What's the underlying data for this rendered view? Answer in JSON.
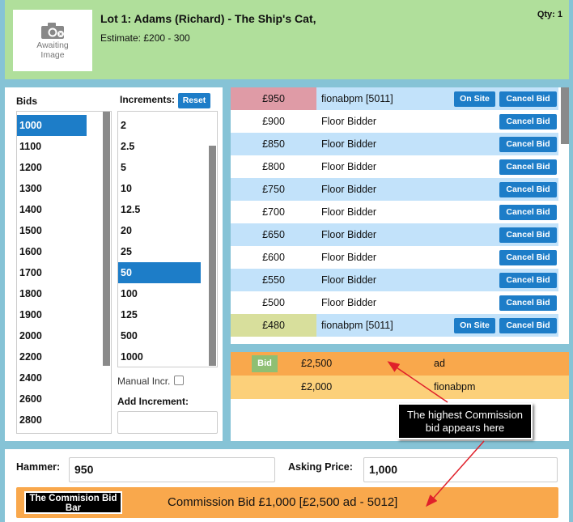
{
  "header": {
    "image_caption": "Awaiting Image",
    "lot_title": "Lot 1: Adams (Richard) - The Ship's Cat,",
    "estimate": "Estimate: £200 - 300",
    "qty": "Qty: 1"
  },
  "bids": {
    "label": "Bids",
    "items": [
      "1000",
      "1100",
      "1200",
      "1300",
      "1400",
      "1500",
      "1600",
      "1700",
      "1800",
      "1900",
      "2000",
      "2200",
      "2400",
      "2600",
      "2800"
    ],
    "selected": "1000"
  },
  "increments": {
    "label": "Increments:",
    "reset_label": "Reset",
    "items": [
      "2",
      "2.5",
      "5",
      "10",
      "12.5",
      "20",
      "25",
      "50",
      "100",
      "125",
      "500",
      "1000"
    ],
    "selected": "50",
    "manual_label": "Manual Incr.",
    "add_label": "Add Increment:",
    "add_value": ""
  },
  "history": {
    "onsite_label": "On Site",
    "cancel_label": "Cancel Bid",
    "rows": [
      {
        "amount": "£950",
        "bidder": "fionabpm [5011]",
        "highlight": "pink",
        "onsite": true,
        "shade": true
      },
      {
        "amount": "£900",
        "bidder": "Floor Bidder",
        "highlight": "",
        "onsite": false,
        "shade": false
      },
      {
        "amount": "£850",
        "bidder": "Floor Bidder",
        "highlight": "",
        "onsite": false,
        "shade": true
      },
      {
        "amount": "£800",
        "bidder": "Floor Bidder",
        "highlight": "",
        "onsite": false,
        "shade": false
      },
      {
        "amount": "£750",
        "bidder": "Floor Bidder",
        "highlight": "",
        "onsite": false,
        "shade": true
      },
      {
        "amount": "£700",
        "bidder": "Floor Bidder",
        "highlight": "",
        "onsite": false,
        "shade": false
      },
      {
        "amount": "£650",
        "bidder": "Floor Bidder",
        "highlight": "",
        "onsite": false,
        "shade": true
      },
      {
        "amount": "£600",
        "bidder": "Floor Bidder",
        "highlight": "",
        "onsite": false,
        "shade": false
      },
      {
        "amount": "£550",
        "bidder": "Floor Bidder",
        "highlight": "",
        "onsite": false,
        "shade": true
      },
      {
        "amount": "£500",
        "bidder": "Floor Bidder",
        "highlight": "",
        "onsite": false,
        "shade": false
      },
      {
        "amount": "£480",
        "bidder": "fionabpm [5011]",
        "highlight": "olive",
        "onsite": true,
        "shade": true
      }
    ]
  },
  "commission": {
    "bid_badge": "Bid",
    "rows": [
      {
        "amount": "£2,500",
        "bidder": "ad",
        "color": "#f9a84c",
        "badge": true
      },
      {
        "amount": "£2,000",
        "bidder": "fionabpm",
        "color": "#fcd07a",
        "badge": false
      }
    ],
    "callout": "The highest Commission bid appears here"
  },
  "bottom": {
    "hammer_label": "Hammer:",
    "hammer_value": "950",
    "asking_label": "Asking Price:",
    "asking_value": "1,000",
    "bar_label": "The Commision Bid Bar",
    "bar_text": "Commission Bid £1,000 [£2,500 ad - 5012]"
  },
  "colors": {
    "header_bg": "#b0df9b",
    "accent_blue": "#1d7dc8",
    "row_blue": "#c2e2fa",
    "commission_orange": "#f9a84c",
    "arrow_red": "#e0202a"
  }
}
